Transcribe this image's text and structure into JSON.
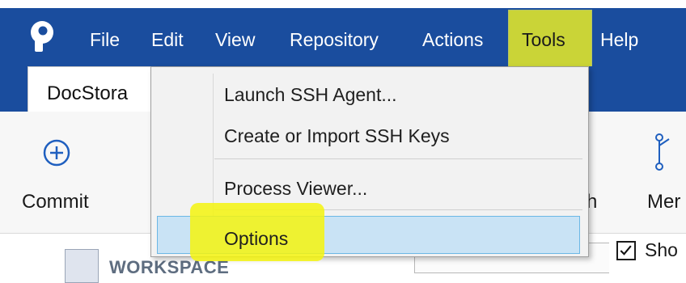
{
  "menubar": {
    "items": [
      "File",
      "Edit",
      "View",
      "Repository",
      "Actions",
      "Tools",
      "Help"
    ],
    "active": "Tools"
  },
  "tab": {
    "label": "DocStora"
  },
  "toolbar": {
    "commit_label": "Commit",
    "branch_partial": "ch",
    "merge_partial": "Mer"
  },
  "lower": {
    "workspace_label": "WORKSPACE",
    "show_partial": "Sho"
  },
  "dropdown": {
    "items": [
      "Launch SSH Agent...",
      "Create or Import SSH Keys",
      "Process Viewer...",
      "Options"
    ],
    "selected": "Options"
  },
  "colors": {
    "menubar_bg": "#1a4d9e",
    "highlight": "#f1f221",
    "selection_bg": "#c9e3f5",
    "selection_border": "#6bb7e6"
  },
  "icons": {
    "logo": "app-logo",
    "commit": "plus-circle-icon",
    "merge": "merge-icon",
    "branch": "branch-icon"
  }
}
